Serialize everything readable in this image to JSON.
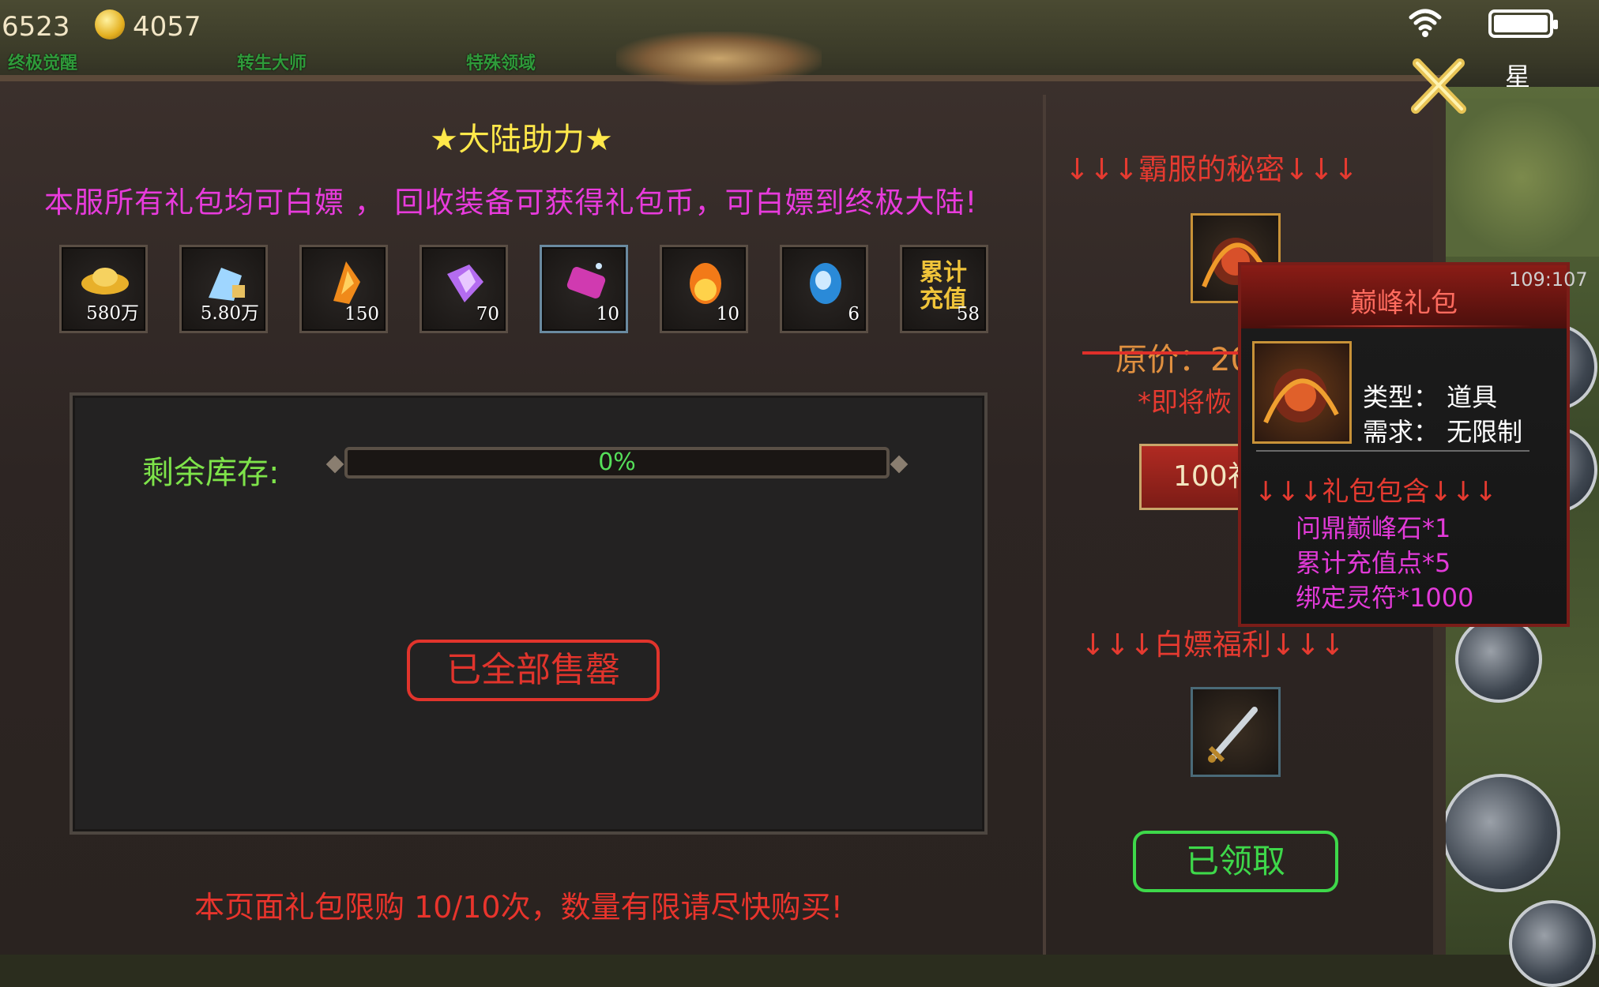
{
  "hud": {
    "left_value": "6523",
    "coin_value": "4057",
    "tabs": [
      "终极觉醒",
      "转生大师",
      "特殊领域"
    ],
    "right_label": "星",
    "timer": "109:107"
  },
  "panel": {
    "title": "★大陆助力★",
    "description": "本服所有礼包均可白嫖 ， 回收装备可获得礼包币，可白嫖到终极大陆!",
    "items": [
      {
        "icon": "gold-ingot-icon",
        "count": "580万"
      },
      {
        "icon": "locked-gem-icon",
        "count": "5.80万"
      },
      {
        "icon": "fire-crystal-icon",
        "count": "150"
      },
      {
        "icon": "purple-crystal-icon",
        "count": "70"
      },
      {
        "icon": "pink-scroll-icon",
        "count": "10"
      },
      {
        "icon": "fire-egg-icon",
        "count": "10"
      },
      {
        "icon": "blue-egg-icon",
        "count": "6"
      },
      {
        "icon": "recharge-text-icon",
        "count": "58",
        "label_line1": "累计",
        "label_line2": "充值"
      }
    ],
    "stock_label": "剩余库存:",
    "stock_percent_text": "0%",
    "stock_fraction": 0,
    "sold_out_label": "已全部售罄",
    "limit_text": "本页面礼包限购 10/10次，数量有限请尽快购买!"
  },
  "side": {
    "secret_title": "↓↓↓霸服的秘密↓↓↓",
    "original_price": "原价：20",
    "restore_text": "*即将恢",
    "coin_button": "100礼包币",
    "freebie_title": "↓↓↓白嫖福利↓↓↓",
    "claimed_button": "已领取"
  },
  "tooltip": {
    "name": "巅峰礼包",
    "type_line": "类型：  道具",
    "req_line": "需求：  无限制",
    "contents_title": "↓↓↓礼包包含↓↓↓",
    "contents": [
      "问鼎巅峰石*1",
      "累计充值点*5",
      "绑定灵符*1000"
    ]
  },
  "colors": {
    "title_yellow": "#ffe84a",
    "magenta": "#e83bdc",
    "red": "#e1342c",
    "green": "#3ed84a"
  }
}
